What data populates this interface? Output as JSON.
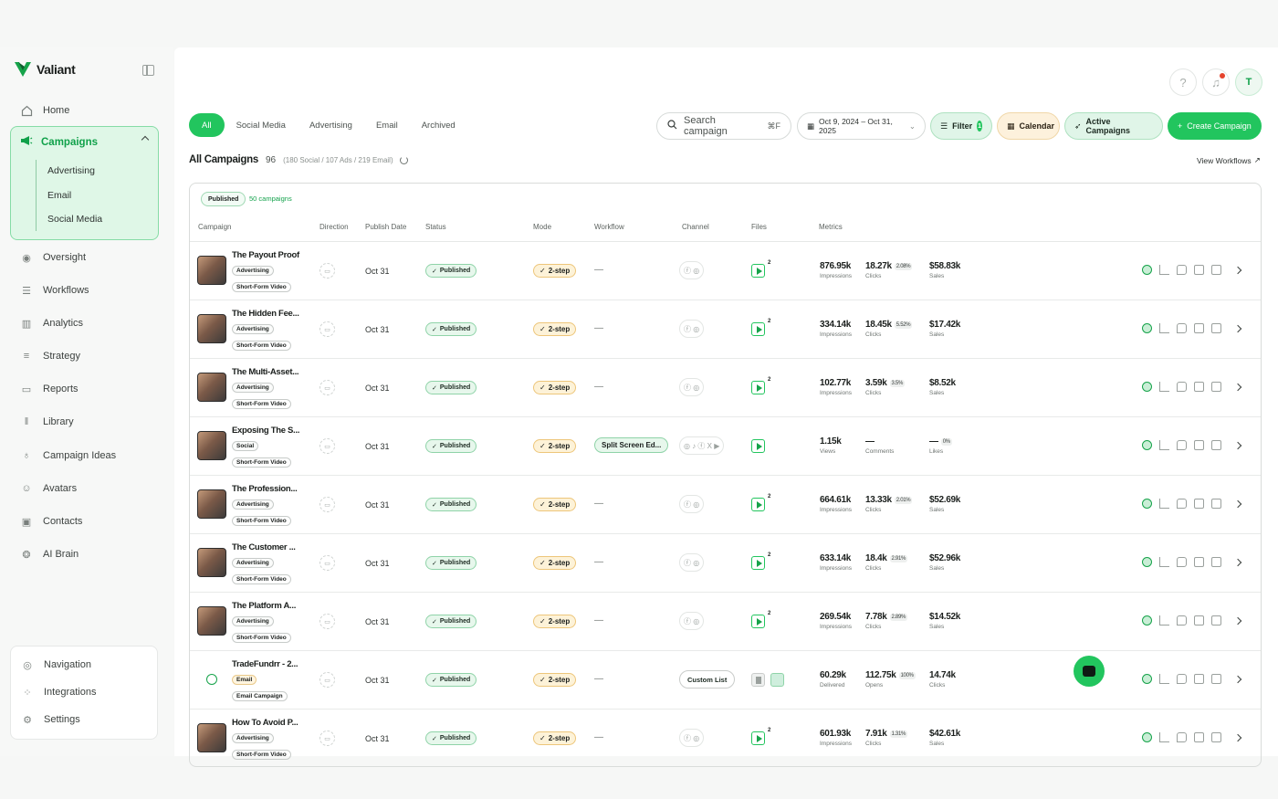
{
  "app": {
    "name": "Valiant"
  },
  "sidebar": {
    "home": "Home",
    "campaigns": "Campaigns",
    "campaign_subs": [
      "Advertising",
      "Email",
      "Social Media"
    ],
    "items": [
      "Oversight",
      "Workflows",
      "Analytics",
      "Strategy",
      "Reports",
      "Library",
      "Campaign Ideas",
      "Avatars",
      "Contacts",
      "AI Brain"
    ],
    "bottom": [
      "Navigation",
      "Integrations",
      "Settings"
    ]
  },
  "header": {
    "avatar_initial": "T",
    "help": "?"
  },
  "tabs": [
    "All",
    "Social Media",
    "Advertising",
    "Email",
    "Archived"
  ],
  "search": {
    "placeholder": "Search campaign",
    "shortcut": "⌘F"
  },
  "date_range": "Oct 9, 2024 – Oct 31, 2025",
  "buttons": {
    "filter": "Filter",
    "filter_count": "1",
    "calendar": "Calendar",
    "active": "Active Campaigns",
    "create": "Create Campaign",
    "view_workflows": "View Workflows"
  },
  "summary": {
    "title": "All Campaigns",
    "count": "96",
    "breakdown": "(180 Social / 107 Ads / 219 Email)"
  },
  "table": {
    "group_tag": "Published",
    "group_count": "50 campaigns",
    "headers": [
      "Campaign",
      "Direction",
      "Publish Date",
      "Status",
      "Mode",
      "Workflow",
      "Channel",
      "Files",
      "Metrics"
    ],
    "rows": [
      {
        "name": "The Payout Proof",
        "tag1": "Advertising",
        "tag2": "Short-Form Video",
        "date": "Oct 31",
        "status": "Published",
        "mode": "2-step",
        "workflow": "—",
        "channel": "ⓕ ◎",
        "m1": "876.95k",
        "l1": "Impressions",
        "m2": "18.27k",
        "p2": "2.08%",
        "l2": "Clicks",
        "m3": "$58.83k",
        "l3": "Sales"
      },
      {
        "name": "The Hidden Fee...",
        "tag1": "Advertising",
        "tag2": "Short-Form Video",
        "date": "Oct 31",
        "status": "Published",
        "mode": "2-step",
        "workflow": "—",
        "channel": "ⓕ ◎",
        "m1": "334.14k",
        "l1": "Impressions",
        "m2": "18.45k",
        "p2": "5.52%",
        "l2": "Clicks",
        "m3": "$17.42k",
        "l3": "Sales"
      },
      {
        "name": "The Multi-Asset...",
        "tag1": "Advertising",
        "tag2": "Short-Form Video",
        "date": "Oct 31",
        "status": "Published",
        "mode": "2-step",
        "workflow": "—",
        "channel": "ⓕ ◎",
        "m1": "102.77k",
        "l1": "Impressions",
        "m2": "3.59k",
        "p2": "3.5%",
        "l2": "Clicks",
        "m3": "$8.52k",
        "l3": "Sales"
      },
      {
        "name": "Exposing The S...",
        "tag1": "Social",
        "tag2": "Short-Form Video",
        "date": "Oct 31",
        "status": "Published",
        "mode": "2-step",
        "workflow": "Split Screen Ed...",
        "channel": "◎ ♪ ⓕ X ▶",
        "m1": "1.15k",
        "l1": "Views",
        "m2": "—",
        "p2": "",
        "l2": "Comments",
        "m3": "—",
        "p3": "0%",
        "l3": "Likes"
      },
      {
        "name": "The Profession...",
        "tag1": "Advertising",
        "tag2": "Short-Form Video",
        "date": "Oct 31",
        "status": "Published",
        "mode": "2-step",
        "workflow": "—",
        "channel": "ⓕ ◎",
        "m1": "664.61k",
        "l1": "Impressions",
        "m2": "13.33k",
        "p2": "2.01%",
        "l2": "Clicks",
        "m3": "$52.69k",
        "l3": "Sales"
      },
      {
        "name": "The Customer ...",
        "tag1": "Advertising",
        "tag2": "Short-Form Video",
        "date": "Oct 31",
        "status": "Published",
        "mode": "2-step",
        "workflow": "—",
        "channel": "ⓕ ◎",
        "m1": "633.14k",
        "l1": "Impressions",
        "m2": "18.4k",
        "p2": "2.91%",
        "l2": "Clicks",
        "m3": "$52.96k",
        "l3": "Sales"
      },
      {
        "name": "The Platform A...",
        "tag1": "Advertising",
        "tag2": "Short-Form Video",
        "date": "Oct 31",
        "status": "Published",
        "mode": "2-step",
        "workflow": "—",
        "channel": "ⓕ ◎",
        "m1": "269.54k",
        "l1": "Impressions",
        "m2": "7.78k",
        "p2": "2.89%",
        "l2": "Clicks",
        "m3": "$14.52k",
        "l3": "Sales"
      },
      {
        "name": "TradeFundrr - 2...",
        "tag1": "Email",
        "tag2": "Email Campaign",
        "date": "Oct 31",
        "status": "Published",
        "mode": "2-step",
        "workflow": "—",
        "channel": "Custom List",
        "m1": "60.29k",
        "l1": "Delivered",
        "m2": "112.75k",
        "p2": "100%",
        "l2": "Opens",
        "m3": "14.74k",
        "l3": "Clicks"
      },
      {
        "name": "How To Avoid P...",
        "tag1": "Advertising",
        "tag2": "Short-Form Video",
        "date": "Oct 31",
        "status": "Published",
        "mode": "2-step",
        "workflow": "—",
        "channel": "ⓕ ◎",
        "m1": "601.93k",
        "l1": "Impressions",
        "m2": "7.91k",
        "p2": "1.31%",
        "l2": "Clicks",
        "m3": "$42.61k",
        "l3": "Sales"
      }
    ]
  },
  "colors": {
    "accent": "#22c55e",
    "accent_dark": "#10a14a",
    "mode_bg": "#fdf2d8",
    "calendar_bg": "#fdf1dc"
  }
}
